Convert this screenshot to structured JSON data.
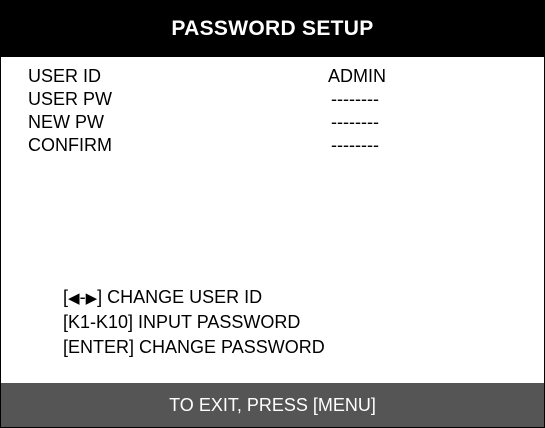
{
  "header": {
    "title": "PASSWORD SETUP"
  },
  "fields": [
    {
      "label": "USER ID",
      "value": "ADMIN"
    },
    {
      "label": "USER PW",
      "value": "--------"
    },
    {
      "label": "NEW PW",
      "value": "--------"
    },
    {
      "label": "CONFIRM",
      "value": "--------"
    }
  ],
  "help": {
    "line1_open": "[",
    "line1_left_icon": "left-arrow-icon",
    "line1_dash": "-",
    "line1_right_icon": "right-arrow-icon",
    "line1_text": "] CHANGE USER ID",
    "line2": "[K1-K10] INPUT PASSWORD",
    "line3": "[ENTER] CHANGE PASSWORD"
  },
  "footer": {
    "text": "TO EXIT, PRESS [MENU]"
  },
  "colors": {
    "header_bg": "#000000",
    "header_fg": "#ffffff",
    "footer_bg": "#555555",
    "footer_fg": "#ffffff"
  }
}
